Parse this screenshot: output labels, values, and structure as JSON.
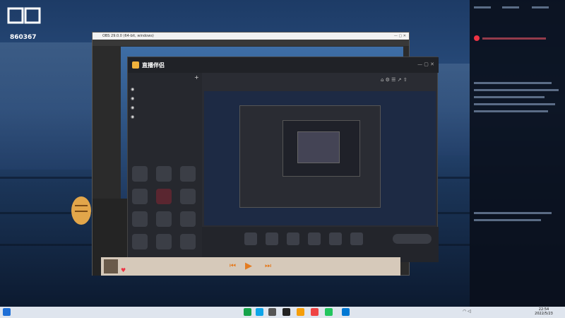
{
  "logo": {
    "id_text": "860367"
  },
  "obs": {
    "title": "OBS 29.0.0 (64-bit, windows)",
    "menu": [
      "",
      "",
      "",
      "",
      "",
      "",
      ""
    ],
    "scene_label": ""
  },
  "main_window": {
    "app_name": "直播伴侣",
    "tabs": [
      "",
      "",
      ""
    ],
    "scenes": [
      "",
      "",
      "",
      ""
    ],
    "stream_title": "",
    "stats": [
      "",
      "",
      "",
      ""
    ],
    "tools_label": "",
    "tools": [
      "",
      "",
      "",
      "",
      "",
      "",
      "",
      "",
      "",
      "",
      "",
      ""
    ],
    "bottom_tools": [
      "",
      "",
      "",
      "",
      "",
      ""
    ],
    "start_button": ""
  },
  "overlay_text": "",
  "music": {
    "song": "",
    "time": ""
  },
  "right_panel": {
    "greeting": ""
  },
  "taskbar": {
    "time": "22:54",
    "date": "2022/5/23"
  }
}
